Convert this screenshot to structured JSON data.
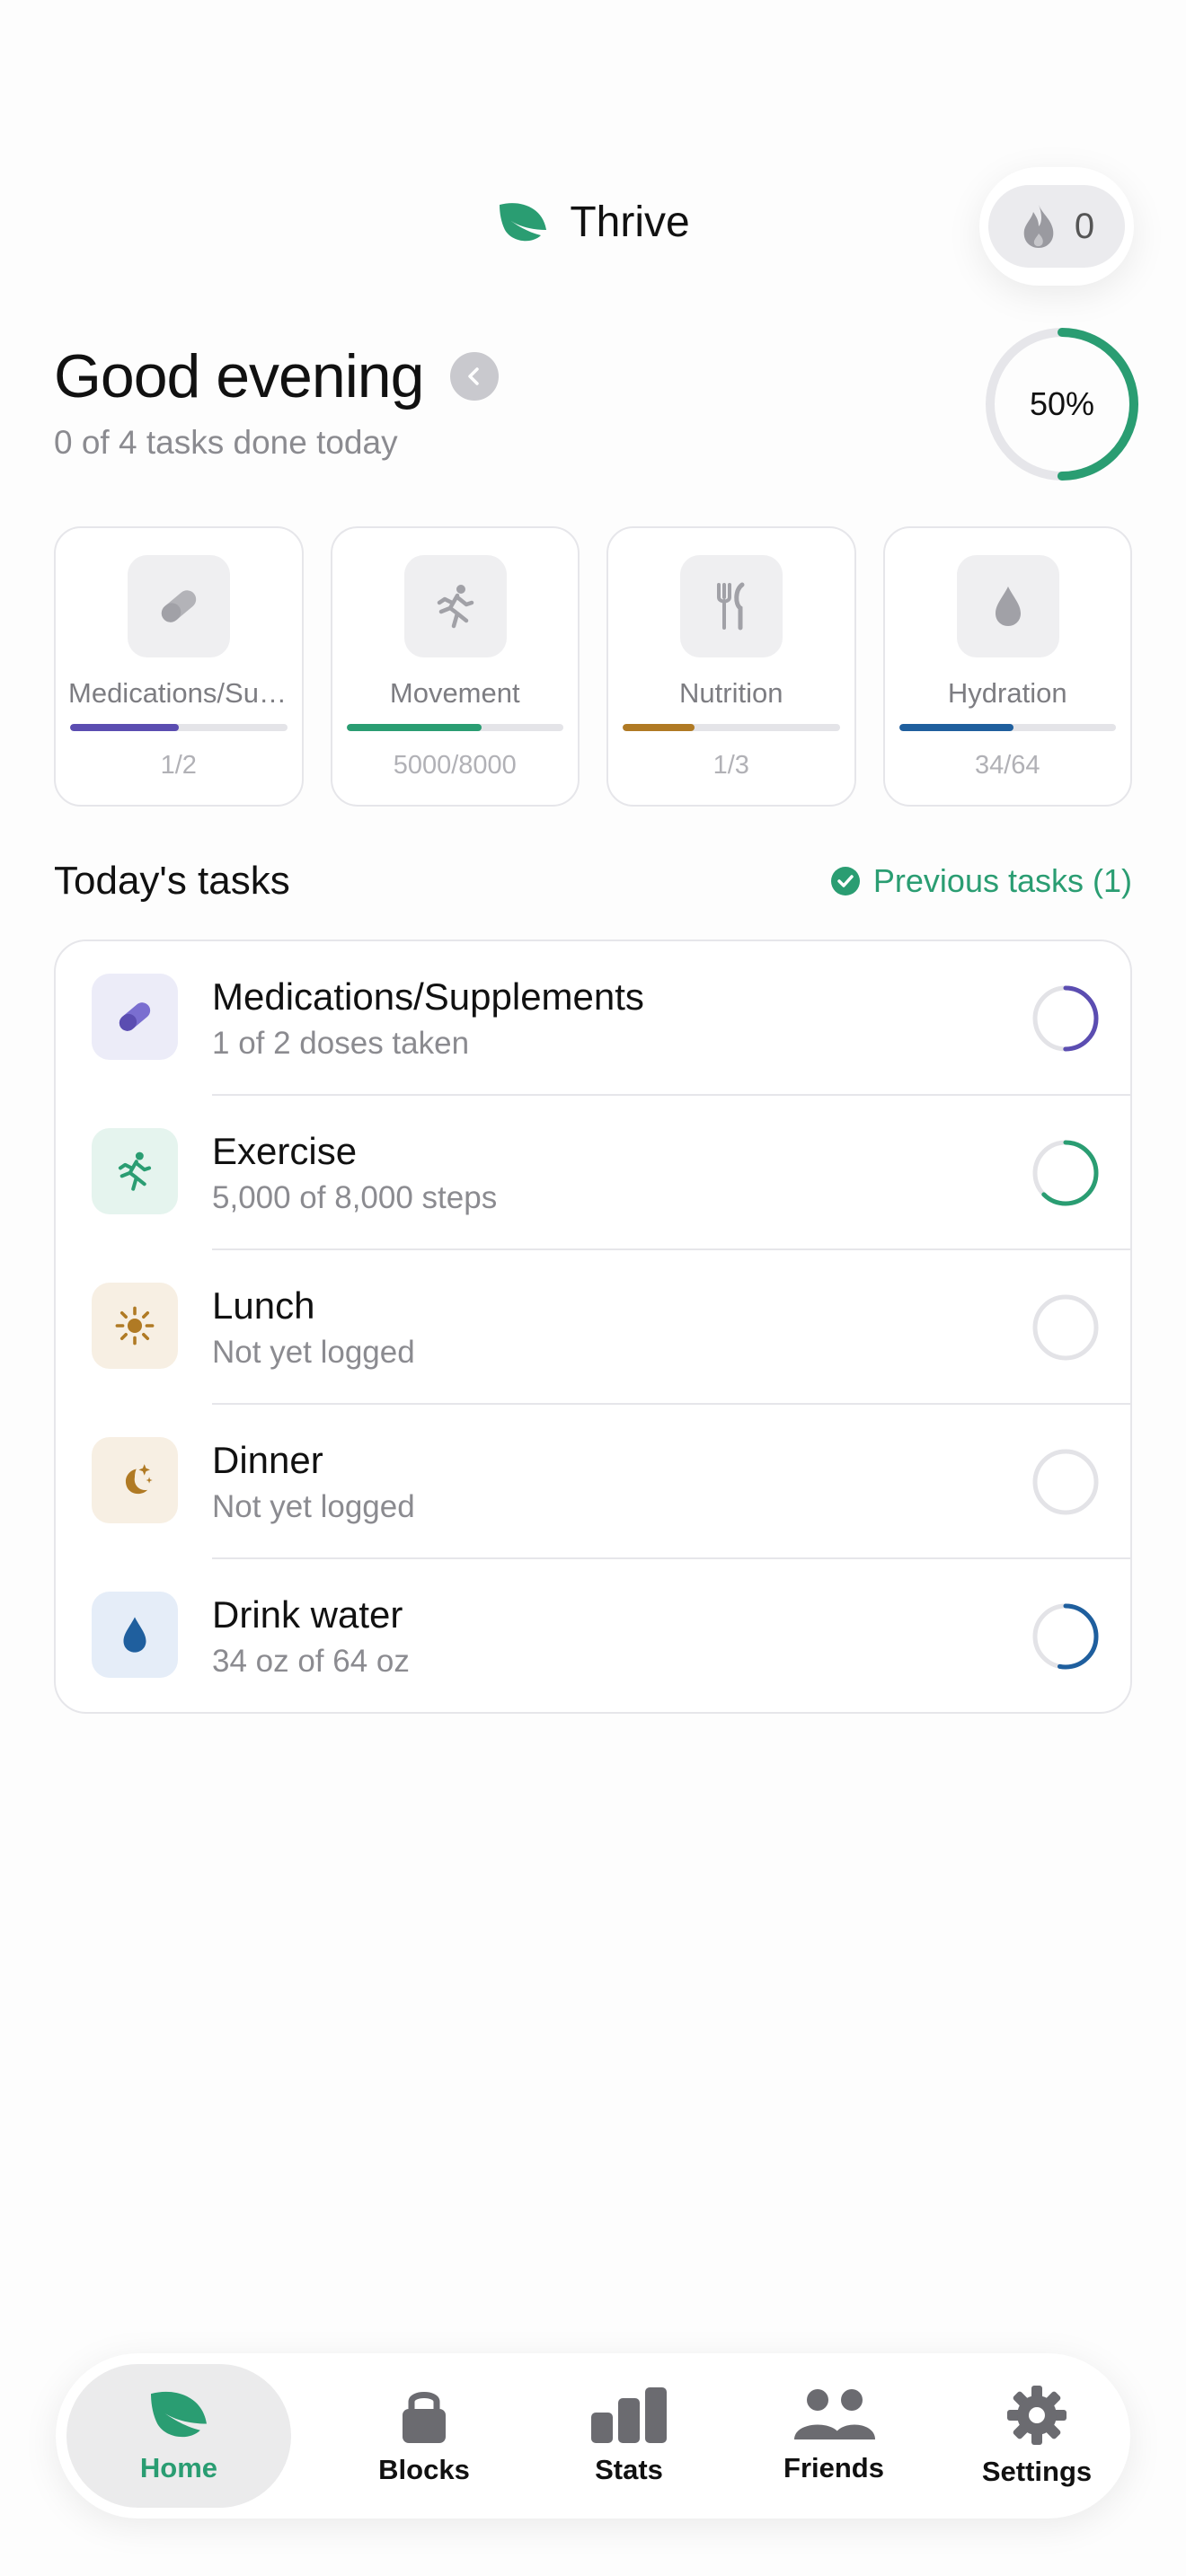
{
  "header": {
    "app_name": "Thrive",
    "streak_count": "0",
    "brand_color": "#2a9d72"
  },
  "greeting": {
    "title": "Good evening",
    "subtitle": "0 of 4 tasks done today",
    "progress_label": "50%",
    "progress": 0.5
  },
  "categories": [
    {
      "label": "Medications/Supplements",
      "value": "1/2",
      "progress": 0.5,
      "color": "#5b4db1",
      "icon": "pill-icon"
    },
    {
      "label": "Movement",
      "value": "5000/8000",
      "progress": 0.625,
      "color": "#2a9d72",
      "icon": "runner-icon"
    },
    {
      "label": "Nutrition",
      "value": "1/3",
      "progress": 0.333,
      "color": "#b07a24",
      "icon": "fork-knife-icon"
    },
    {
      "label": "Hydration",
      "value": "34/64",
      "progress": 0.53,
      "color": "#1f5f9e",
      "icon": "water-drop-icon"
    }
  ],
  "tasks_section": {
    "title": "Today's tasks",
    "previous_label": "Previous tasks (1)"
  },
  "tasks": [
    {
      "name": "Medications/Supplements",
      "sub": "1 of 2 doses taken",
      "progress": 0.5,
      "color": "#5b4db1",
      "bg": "#ececf8",
      "icon": "pill-icon"
    },
    {
      "name": "Exercise",
      "sub": "5,000 of 8,000 steps",
      "progress": 0.625,
      "color": "#2a9d72",
      "bg": "#e5f4ee",
      "icon": "runner-icon"
    },
    {
      "name": "Lunch",
      "sub": "Not yet logged",
      "progress": 0,
      "color": "#b07a24",
      "bg": "#f7efe3",
      "icon": "sun-icon"
    },
    {
      "name": "Dinner",
      "sub": "Not yet logged",
      "progress": 0,
      "color": "#b07a24",
      "bg": "#f7efe3",
      "icon": "moon-stars-icon"
    },
    {
      "name": "Drink water",
      "sub": "34 oz of 64 oz",
      "progress": 0.53,
      "color": "#1f5f9e",
      "bg": "#e5edf8",
      "icon": "water-drop-icon"
    }
  ],
  "nav": [
    {
      "label": "Home",
      "icon": "leaf-icon",
      "active": true
    },
    {
      "label": "Blocks",
      "icon": "lock-icon",
      "active": false
    },
    {
      "label": "Stats",
      "icon": "bar-chart-icon",
      "active": false
    },
    {
      "label": "Friends",
      "icon": "people-icon",
      "active": false
    },
    {
      "label": "Settings",
      "icon": "gear-icon",
      "active": false
    }
  ]
}
